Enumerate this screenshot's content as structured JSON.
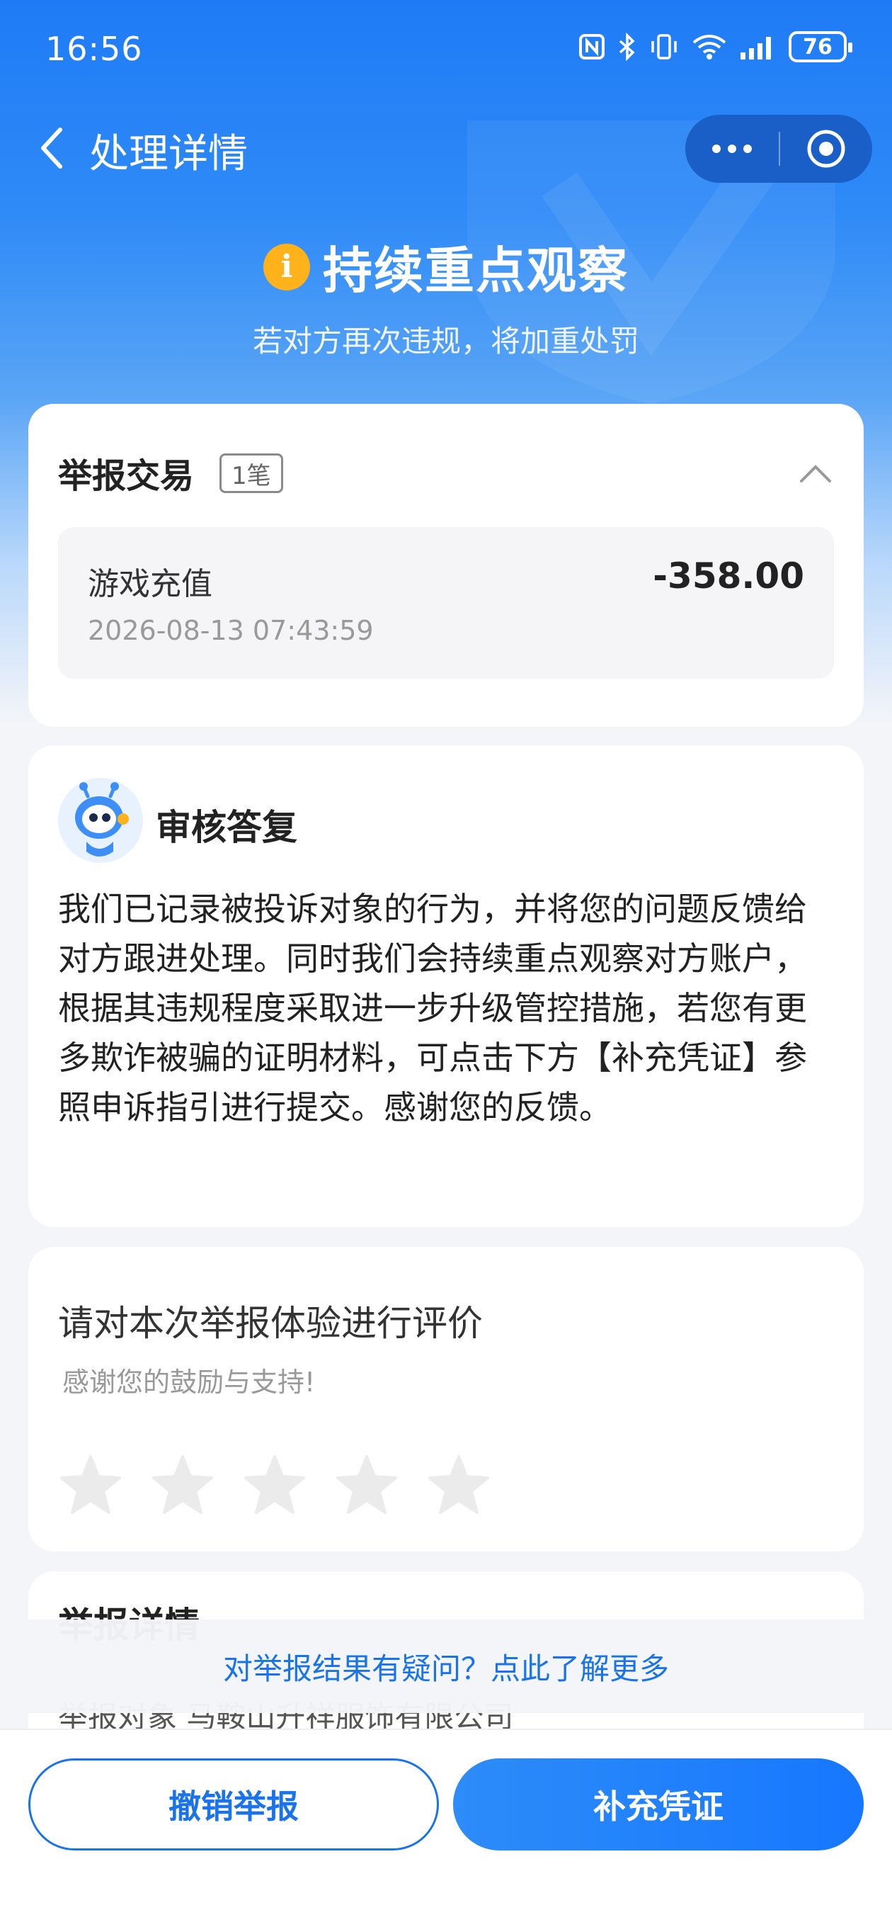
{
  "status_bar": {
    "time": "16:56",
    "battery": "76"
  },
  "nav": {
    "title": "处理详情"
  },
  "result": {
    "title": "持续重点观察",
    "subtitle": "若对方再次违规，将加重处罚"
  },
  "trade_card": {
    "title": "举报交易",
    "count": "1笔",
    "item": {
      "name": "游戏充值",
      "amount": "-358.00",
      "time": "2026-08-13 07:43:59"
    }
  },
  "reply_card": {
    "title": "审核答复",
    "body": "我们已记录被投诉对象的行为，并将您的问题反馈给对方跟进处理。同时我们会持续重点观察对方账户，根据其违规程度采取进一步升级管控措施，若您有更多欺诈被骗的证明材料，可点击下方【补充凭证】参照申诉指引进行提交。感谢您的反馈。"
  },
  "rating_card": {
    "title": "请对本次举报体验进行评价",
    "subtitle": "感谢您的鼓励与支持!",
    "stars": [
      0,
      0,
      0,
      0,
      0
    ]
  },
  "detail_card": {
    "title": "举报详情",
    "peek_text": "举报对象  马鞍山升祥服饰有限公司"
  },
  "doubt_link": "对举报结果有疑问？点此了解更多",
  "buttons": {
    "cancel": "撤销举报",
    "supplement": "补充凭证"
  },
  "colors": {
    "primary": "#1a73e8",
    "hero": "#1f7bf5",
    "warning": "#ffb21a"
  },
  "icons": [
    "nfc-icon",
    "bluetooth-icon",
    "vibrate-icon",
    "wifi-icon",
    "signal-icon",
    "battery-icon",
    "back-icon",
    "more-icon",
    "target-icon",
    "info-icon",
    "chevron-up-icon",
    "robot-avatar",
    "star-icon"
  ]
}
